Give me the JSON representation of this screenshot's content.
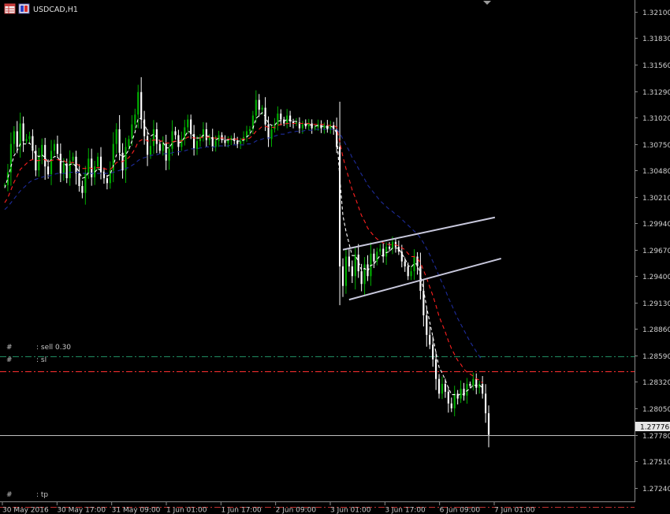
{
  "header": {
    "symbol_title": "USDCAD,H1"
  },
  "icons": [
    "table-icon",
    "chart-flag-icon",
    "scroll-marker-icon"
  ],
  "colors": {
    "background": "#000000",
    "bull": "#00b000",
    "bear": "#ffffff",
    "ma_fast": "#ffffff",
    "ma_mid": "#ff2020",
    "ma_slow": "#1e2c9c",
    "channel": "#c8c8dc",
    "order_line": "#ff3030",
    "tp_line": "#c03030",
    "sell_line": "#208a60",
    "current_price_line": "#bfbfbf",
    "axis": "#8a8a8a"
  },
  "order_labels": [
    {
      "id": "sell",
      "hash": "#",
      "text": ": sell 0.30",
      "price": 1.2858
    },
    {
      "id": "sl",
      "hash": "#",
      "text": ": sl",
      "price": 1.2843
    },
    {
      "id": "tp",
      "hash": "#",
      "text": ": tp",
      "price": 1.2704
    }
  ],
  "current_price": {
    "value": 1.2778,
    "label": "1.27776"
  },
  "chart_data": {
    "type": "line",
    "symbol": "USDCAD",
    "timeframe": "H1",
    "title": "USDCAD,H1",
    "ylim": [
      1.271,
      1.3222
    ],
    "y_ticks": [
      "1.32100",
      "1.31830",
      "1.31560",
      "1.31290",
      "1.31020",
      "1.30750",
      "1.30480",
      "1.30210",
      "1.29940",
      "1.29670",
      "1.29400",
      "1.29130",
      "1.28860",
      "1.28590",
      "1.28320",
      "1.28050",
      "1.27780",
      "1.27510",
      "1.27240"
    ],
    "x_ticks": [
      "30 May 2016",
      "30 May 17:00",
      "31 May 09:00",
      "1 Jun 01:00",
      "1 Jun 17:00",
      "2 Jun 09:00",
      "3 Jun 01:00",
      "3 Jun 17:00",
      "6 Jun 09:00",
      "7 Jun 01:00"
    ],
    "grid": false,
    "series": [
      {
        "kind": "price",
        "values": [
          1.3033,
          1.3046,
          1.3075,
          1.3088,
          1.3072,
          1.3096,
          1.3078,
          1.308,
          1.3083,
          1.3068,
          1.3048,
          1.3062,
          1.3074,
          1.3052,
          1.3044,
          1.3068,
          1.3075,
          1.3065,
          1.3045,
          1.3055,
          1.304,
          1.3058,
          1.3062,
          1.3045,
          1.3032,
          1.3025,
          1.3045,
          1.306,
          1.3041,
          1.3052,
          1.3062,
          1.3046,
          1.304,
          1.3035,
          1.3048,
          1.3075,
          1.309,
          1.3066,
          1.3048,
          1.3072,
          1.308,
          1.3095,
          1.3105,
          1.3128,
          1.31,
          1.3083,
          1.3064,
          1.3073,
          1.309,
          1.3075,
          1.3068,
          1.3076,
          1.3058,
          1.307,
          1.3088,
          1.3084,
          1.3072,
          1.308,
          1.3092,
          1.31,
          1.3085,
          1.307,
          1.3078,
          1.3082,
          1.309,
          1.3079,
          1.3082,
          1.3072,
          1.3078,
          1.3084,
          1.3079,
          1.3076,
          1.3079,
          1.3081,
          1.3078,
          1.3075,
          1.3078,
          1.3082,
          1.3088,
          1.309,
          1.3104,
          1.312,
          1.311,
          1.3112,
          1.3095,
          1.308,
          1.309,
          1.3095,
          1.3106,
          1.31,
          1.3096,
          1.3104,
          1.3098,
          1.3096,
          1.3097,
          1.3091,
          1.3095,
          1.3093,
          1.3096,
          1.3091,
          1.3092,
          1.3095,
          1.3091,
          1.3094,
          1.309,
          1.3094,
          1.309,
          1.3072,
          1.295,
          1.293,
          1.296,
          1.295,
          1.294,
          1.2962,
          1.2945,
          1.2932,
          1.2952,
          1.294,
          1.2963,
          1.2955,
          1.2965,
          1.2968,
          1.296,
          1.297,
          1.2968,
          1.2975,
          1.297,
          1.2965,
          1.2955,
          1.295,
          1.294,
          1.2945,
          1.296,
          1.295,
          1.2925,
          1.29,
          1.288,
          1.287,
          1.2855,
          1.2835,
          1.282,
          1.283,
          1.2822,
          1.281,
          1.2805,
          1.282,
          1.2815,
          1.2825,
          1.2818,
          1.283,
          1.2828,
          1.2835,
          1.2826,
          1.283,
          1.282,
          1.28,
          1.2778
        ]
      },
      {
        "name": "",
        "kind": "ma",
        "color": "#ffffff",
        "dash": "4 3",
        "values": [
          1.303,
          1.304,
          1.3052,
          1.3063,
          1.3068,
          1.3075,
          1.3075,
          1.3075,
          1.3076,
          1.3071,
          1.3064,
          1.3062,
          1.3064,
          1.3061,
          1.3056,
          1.3059,
          1.3062,
          1.3062,
          1.3057,
          1.3057,
          1.3052,
          1.3054,
          1.3055,
          1.3052,
          1.3046,
          1.304,
          1.3041,
          1.3046,
          1.3044,
          1.3046,
          1.305,
          1.3048,
          1.3046,
          1.3042,
          1.3044,
          1.3053,
          1.3064,
          1.3065,
          1.3061,
          1.3064,
          1.3069,
          1.3078,
          1.3087,
          1.3101,
          1.3101,
          1.3096,
          1.3087,
          1.3083,
          1.3085,
          1.3082,
          1.3078,
          1.3077,
          1.3071,
          1.3071,
          1.3076,
          1.3078,
          1.3076,
          1.3077,
          1.3082,
          1.3088,
          1.3087,
          1.3082,
          1.3081,
          1.3081,
          1.3084,
          1.3083,
          1.3083,
          1.308,
          1.3079,
          1.3081,
          1.308,
          1.3079,
          1.3079,
          1.308,
          1.3079,
          1.3078,
          1.3078,
          1.3079,
          1.3082,
          1.3085,
          1.3091,
          1.3101,
          1.3104,
          1.3107,
          1.3103,
          1.3096,
          1.3094,
          1.3094,
          1.3098,
          1.3099,
          1.3098,
          1.31,
          1.3099,
          1.3098,
          1.3098,
          1.3096,
          1.3096,
          1.3095,
          1.3095,
          1.3094,
          1.3093,
          1.3094,
          1.3093,
          1.3093,
          1.3092,
          1.3093,
          1.3092,
          1.3086,
          1.304,
          1.3002,
          1.2986,
          1.2973,
          1.2961,
          1.2961,
          1.2955,
          1.2946,
          1.2948,
          1.2945,
          1.2951,
          1.2952,
          1.2957,
          1.2961,
          1.2961,
          1.2964,
          1.2965,
          1.2969,
          1.2969,
          1.2968,
          1.2963,
          1.2958,
          1.2951,
          1.2949,
          1.2953,
          1.2952,
          1.2941,
          1.2926,
          1.2908,
          1.2893,
          1.2878,
          1.2862,
          1.2847,
          1.2841,
          1.2834,
          1.2826,
          1.2819,
          1.2819,
          1.2818,
          1.282,
          1.2819,
          1.2823,
          1.2825,
          1.2829,
          1.2828,
          1.2829,
          1.2826
        ]
      },
      {
        "name": "",
        "kind": "ma",
        "color": "#ff2020",
        "dash": "5 4",
        "values": [
          1.3015,
          1.302,
          1.3028,
          1.3036,
          1.3042,
          1.3049,
          1.3052,
          1.3055,
          1.3058,
          1.3059,
          1.3058,
          1.3058,
          1.3059,
          1.3059,
          1.3057,
          1.3058,
          1.3059,
          1.3059,
          1.3058,
          1.3058,
          1.3056,
          1.3056,
          1.3056,
          1.3055,
          1.3053,
          1.305,
          1.305,
          1.3051,
          1.305,
          1.305,
          1.3051,
          1.3051,
          1.305,
          1.3049,
          1.3049,
          1.3052,
          1.3056,
          1.3057,
          1.3057,
          1.3059,
          1.3061,
          1.3065,
          1.307,
          1.3077,
          1.3079,
          1.308,
          1.3078,
          1.3078,
          1.3079,
          1.3079,
          1.3078,
          1.3078,
          1.3076,
          1.3076,
          1.3077,
          1.3078,
          1.3078,
          1.3078,
          1.308,
          1.3082,
          1.3082,
          1.3081,
          1.3081,
          1.3081,
          1.3082,
          1.3082,
          1.3082,
          1.3081,
          1.3081,
          1.3081,
          1.3081,
          1.3081,
          1.308,
          1.308,
          1.308,
          1.308,
          1.308,
          1.308,
          1.308,
          1.3081,
          1.3084,
          1.3088,
          1.309,
          1.3093,
          1.3093,
          1.3092,
          1.3092,
          1.3092,
          1.3094,
          1.3095,
          1.3095,
          1.3096,
          1.3096,
          1.3096,
          1.3096,
          1.3096,
          1.3096,
          1.3096,
          1.3096,
          1.3095,
          1.3095,
          1.3095,
          1.3095,
          1.3095,
          1.3094,
          1.3094,
          1.3094,
          1.3092,
          1.3077,
          1.3062,
          1.305,
          1.3039,
          1.3028,
          1.302,
          1.3011,
          1.3002,
          1.2996,
          1.2989,
          1.2985,
          1.2981,
          1.2978,
          1.2976,
          1.2974,
          1.2973,
          1.2972,
          1.2972,
          1.2972,
          1.2971,
          1.2969,
          1.2967,
          1.2963,
          1.296,
          1.296,
          1.2958,
          1.2954,
          1.2946,
          1.2938,
          1.2929,
          1.292,
          1.291,
          1.2899,
          1.2891,
          1.2883,
          1.2874,
          1.2866,
          1.286,
          1.2854,
          1.285,
          1.2845,
          1.2842,
          1.284,
          1.2838,
          1.2835,
          1.2834,
          1.2831
        ]
      },
      {
        "name": "",
        "kind": "ma",
        "color": "#1e2c9c",
        "dash": "5 4",
        "values": [
          1.3008,
          1.3011,
          1.3015,
          1.3019,
          1.3023,
          1.3027,
          1.303,
          1.3033,
          1.3036,
          1.3038,
          1.3039,
          1.304,
          1.3041,
          1.3042,
          1.3042,
          1.3043,
          1.3044,
          1.3045,
          1.3045,
          1.3045,
          1.3045,
          1.3046,
          1.3046,
          1.3046,
          1.3046,
          1.3045,
          1.3045,
          1.3045,
          1.3045,
          1.3045,
          1.3045,
          1.3045,
          1.3045,
          1.3045,
          1.3045,
          1.3046,
          1.3047,
          1.3048,
          1.3049,
          1.305,
          1.3051,
          1.3053,
          1.3055,
          1.3058,
          1.306,
          1.3061,
          1.3062,
          1.3063,
          1.3064,
          1.3064,
          1.3065,
          1.3065,
          1.3065,
          1.3065,
          1.3066,
          1.3067,
          1.3067,
          1.3067,
          1.3068,
          1.3069,
          1.307,
          1.307,
          1.307,
          1.3071,
          1.3071,
          1.3072,
          1.3072,
          1.3072,
          1.3072,
          1.3073,
          1.3073,
          1.3073,
          1.3073,
          1.3074,
          1.3074,
          1.3074,
          1.3074,
          1.3074,
          1.3075,
          1.3075,
          1.3076,
          1.3078,
          1.3079,
          1.308,
          1.3081,
          1.3081,
          1.3082,
          1.3083,
          1.3084,
          1.3085,
          1.3085,
          1.3086,
          1.3087,
          1.3087,
          1.3088,
          1.3088,
          1.3088,
          1.3089,
          1.3089,
          1.3089,
          1.309,
          1.309,
          1.309,
          1.309,
          1.309,
          1.309,
          1.309,
          1.309,
          1.3086,
          1.308,
          1.3074,
          1.3068,
          1.3061,
          1.3056,
          1.305,
          1.3044,
          1.3039,
          1.3033,
          1.3029,
          1.3025,
          1.3021,
          1.3017,
          1.3014,
          1.3011,
          1.3008,
          1.3006,
          1.3003,
          1.3001,
          1.2998,
          1.2995,
          1.2992,
          1.2989,
          1.2986,
          1.2983,
          1.2979,
          1.2974,
          1.2968,
          1.2962,
          1.2955,
          1.2948,
          1.294,
          1.2933,
          1.2926,
          1.2918,
          1.2911,
          1.2904,
          1.2897,
          1.2891,
          1.2885,
          1.2879,
          1.2873,
          1.2868,
          1.2863,
          1.2858,
          1.2854
        ]
      }
    ],
    "channel_lines": [
      {
        "x": [
          109,
          158
        ],
        "y": [
          1.2967,
          1.3
        ]
      },
      {
        "x": [
          111,
          160
        ],
        "y": [
          1.2916,
          1.2958
        ]
      }
    ]
  }
}
